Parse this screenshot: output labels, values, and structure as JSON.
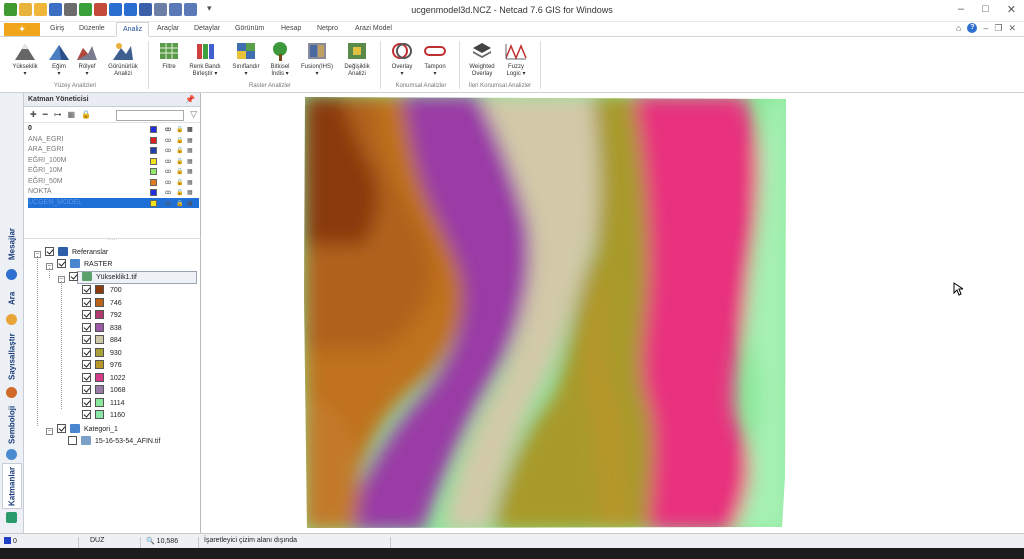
{
  "window": {
    "title": "ucgenmodel3d.NCZ - Netcad 7.6 GIS for Windows",
    "controls": [
      "–",
      "□",
      "✕"
    ]
  },
  "quick_access": {
    "dropdown": "▾",
    "icon_colors": [
      "#3f9a2f",
      "#e9b23a",
      "#f0b63a",
      "#3a6fc4",
      "#6c6c6c",
      "#3aa13a",
      "#c44a3a",
      "#2a6fd0",
      "#2a6fd0",
      "#3b5fa8",
      "#6d7fa6",
      "#5a79b6",
      "#5a79b6"
    ]
  },
  "ribbon_tabs": {
    "file_glyph": "✦",
    "items": [
      "Giriş",
      "Düzenle",
      "Analiz",
      "Araçlar",
      "Detaylar",
      "Görünüm",
      "Hesap",
      "Netpro",
      "Arazi Model"
    ],
    "active": "Analiz",
    "right_glyphs": [
      "⌂",
      "?",
      "–",
      "❐",
      "✕"
    ]
  },
  "ribbon": {
    "buttons": [
      {
        "label": "Yükseklik",
        "sub": "▾"
      },
      {
        "label": "Eğim",
        "sub": "▾"
      },
      {
        "label": "Rölyef",
        "sub": "▾"
      },
      {
        "label": "Görünürlük",
        "sub": "Analizi"
      },
      {
        "label": "Filtre",
        "sub": ""
      },
      {
        "label": "Renk Bandı",
        "sub": "Birleştir ▾"
      },
      {
        "label": "Sınıflandır",
        "sub": "▾"
      },
      {
        "label": "Bitkisel",
        "sub": "İndis ▾"
      },
      {
        "label": "Fusion(IHS)",
        "sub": "▾"
      },
      {
        "label": "Değişiklik",
        "sub": "Analizi"
      },
      {
        "label": "Overlay",
        "sub": "▾"
      },
      {
        "label": "Tampon",
        "sub": "▾"
      },
      {
        "label": "Weighted",
        "sub": "Overlay"
      },
      {
        "label": "Fuzzy",
        "sub": "Logic ▾"
      }
    ],
    "groups": [
      "Yüzey Analizleri",
      "Raster Analizler",
      "Konumsal Analizler",
      "İleri Konumsal Analizler"
    ]
  },
  "side_tabs": [
    "Mesajlar",
    "Ara",
    "Sayısallaştır",
    "Semboloji",
    "Katmanlar"
  ],
  "layer_manager": {
    "title": "Katman Yöneticisi",
    "pin": "📌",
    "toolbar": [
      "✚",
      "━",
      "⊶",
      "▦",
      "🔒"
    ],
    "search_value": "",
    "filter_glyph": "▽",
    "row_icons": [
      "ꝏ",
      "🔒",
      "▦"
    ],
    "layers": [
      {
        "name": "0",
        "color": "#1f2ee0",
        "bold": true
      },
      {
        "name": "ANA_EGRI",
        "color": "#e01f1f"
      },
      {
        "name": "ARA_EGRI",
        "color": "#1f3fb0"
      },
      {
        "name": "EĞRI_100M",
        "color": "#f2e31b"
      },
      {
        "name": "EĞRI_10M",
        "color": "#8fe86a"
      },
      {
        "name": "EĞRI_50M",
        "color": "#e07b1f"
      },
      {
        "name": "NOKTA",
        "color": "#1f2ee0"
      },
      {
        "name": "ÜCGEN_MODEL",
        "color": "#f2e31b",
        "selected": true
      }
    ]
  },
  "tree": {
    "expand_minus": "–",
    "references": "Referanslar",
    "raster": "RASTER",
    "raster_file": "Yükseklik1.tif",
    "classes": [
      {
        "label": "700",
        "color": "#8a3a0d"
      },
      {
        "label": "746",
        "color": "#b8621a"
      },
      {
        "label": "792",
        "color": "#b03a6e"
      },
      {
        "label": "838",
        "color": "#9a5aa6"
      },
      {
        "label": "884",
        "color": "#cfc8a6"
      },
      {
        "label": "930",
        "color": "#a8a13a"
      },
      {
        "label": "976",
        "color": "#b8962a"
      },
      {
        "label": "1022",
        "color": "#d63a8a"
      },
      {
        "label": "1068",
        "color": "#9a7aa6"
      },
      {
        "label": "1114",
        "color": "#8ae89a"
      },
      {
        "label": "1160",
        "color": "#8ae8a6"
      }
    ],
    "category": "Kategori_1",
    "category_file": "15-16-53-54_AFIN.tif"
  },
  "status_bar": {
    "layer": "0",
    "mode": "DUZ",
    "scale": "10,586",
    "message": "İşaretleyici çizim alanı dışında"
  }
}
